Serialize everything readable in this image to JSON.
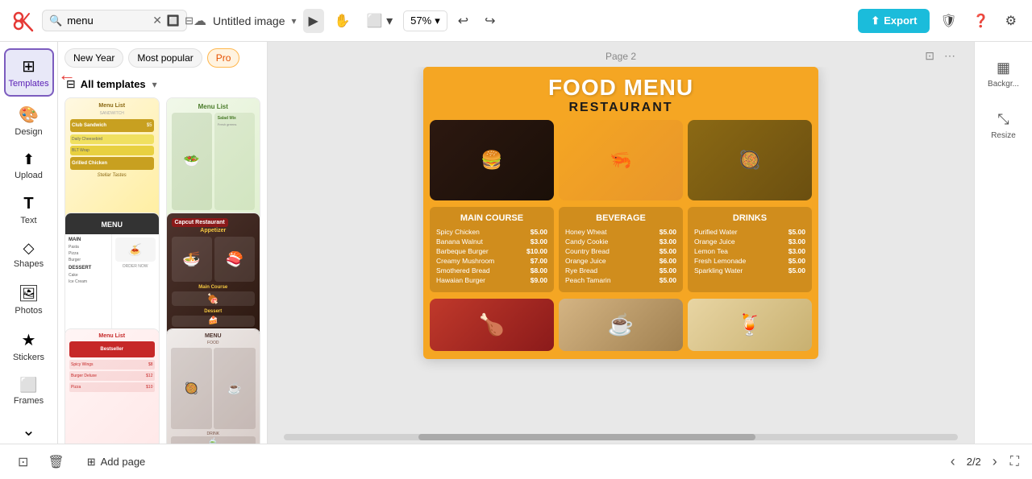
{
  "app": {
    "logo": "✂",
    "title": "Untitled image",
    "page_label": "Page 2",
    "page_current": "2/2",
    "zoom": "57%"
  },
  "topbar": {
    "search_placeholder": "menu",
    "search_value": "menu",
    "export_label": "Export",
    "undo_icon": "↩",
    "redo_icon": "↪",
    "cloud_icon": "☁",
    "dropdown_arrow": "▾",
    "shield_icon": "🛡",
    "help_icon": "?",
    "settings_icon": "⚙"
  },
  "sidebar": {
    "items": [
      {
        "id": "templates",
        "label": "Templates",
        "icon": "⊞",
        "active": true
      },
      {
        "id": "design",
        "label": "Design",
        "icon": "🎨",
        "active": false
      },
      {
        "id": "upload",
        "label": "Upload",
        "icon": "⬆",
        "active": false
      },
      {
        "id": "text",
        "label": "Text",
        "icon": "T",
        "active": false
      },
      {
        "id": "shapes",
        "label": "Shapes",
        "icon": "◇",
        "active": false
      },
      {
        "id": "photos",
        "label": "Photos",
        "icon": "🖼",
        "active": false
      },
      {
        "id": "stickers",
        "label": "Stickers",
        "icon": "★",
        "active": false
      },
      {
        "id": "frames",
        "label": "Frames",
        "icon": "⬜",
        "active": false
      }
    ],
    "more_label": "⌄"
  },
  "templates_panel": {
    "tabs": [
      {
        "id": "new-year",
        "label": "New Year",
        "active": false
      },
      {
        "id": "most-popular",
        "label": "Most popular",
        "active": false
      },
      {
        "id": "pro",
        "label": "Pro",
        "active": false
      }
    ],
    "all_templates_label": "All templates",
    "templates": [
      {
        "id": 1,
        "style": "tmpl1",
        "label": "Menu List\nSANDWICH",
        "has_badge": false
      },
      {
        "id": 2,
        "style": "tmpl2",
        "label": "Menu List",
        "has_badge": false
      },
      {
        "id": 3,
        "style": "tmpl3",
        "label": "MENU",
        "has_badge": false
      },
      {
        "id": 4,
        "style": "tmpl4",
        "label": "Capcut Restaurant",
        "has_badge": true
      },
      {
        "id": 5,
        "style": "tmpl5",
        "label": "Menu List",
        "has_badge": false
      },
      {
        "id": 6,
        "style": "tmpl6",
        "label": "MENU\nFOOD",
        "has_badge": false
      }
    ]
  },
  "canvas": {
    "page_label": "Page 2",
    "food_menu": {
      "title": "FOOD MENU",
      "subtitle": "RESTAURANT",
      "sections": [
        {
          "title": "MAIN COURSE",
          "items": [
            {
              "name": "Spicy Chicken",
              "price": "$5.00"
            },
            {
              "name": "Banana Walnut",
              "price": "$3.00"
            },
            {
              "name": "Barbeque Burger",
              "price": "$10.00"
            },
            {
              "name": "Creamy Mushroom",
              "price": "$7.00"
            },
            {
              "name": "Smothered Bread",
              "price": "$8.00"
            },
            {
              "name": "Hawaian Burger",
              "price": "$9.00"
            }
          ]
        },
        {
          "title": "BEVERAGE",
          "items": [
            {
              "name": "Honey Wheat",
              "price": "$5.00"
            },
            {
              "name": "Candy Cookie",
              "price": "$3.00"
            },
            {
              "name": "Country Bread",
              "price": "$5.00"
            },
            {
              "name": "Orange Juice",
              "price": "$6.00"
            },
            {
              "name": "Rye Bread",
              "price": "$5.00"
            },
            {
              "name": "Peach Tamarin",
              "price": "$5.00"
            }
          ]
        },
        {
          "title": "DRINKS",
          "items": [
            {
              "name": "Purified Water",
              "price": "$5.00"
            },
            {
              "name": "Orange Juice",
              "price": "$3.00"
            },
            {
              "name": "Lemon Tea",
              "price": "$3.00"
            },
            {
              "name": "Fresh Lemonade",
              "price": "$5.00"
            },
            {
              "name": "Sparkling Water",
              "price": "$5.00"
            }
          ]
        }
      ]
    }
  },
  "right_panel": {
    "items": [
      {
        "id": "background",
        "label": "Backgr...",
        "icon": "▦"
      },
      {
        "id": "resize",
        "label": "Resize",
        "icon": "⤡"
      }
    ]
  },
  "bottom_bar": {
    "add_page_label": "Add page",
    "page_indicator": "2/2"
  }
}
